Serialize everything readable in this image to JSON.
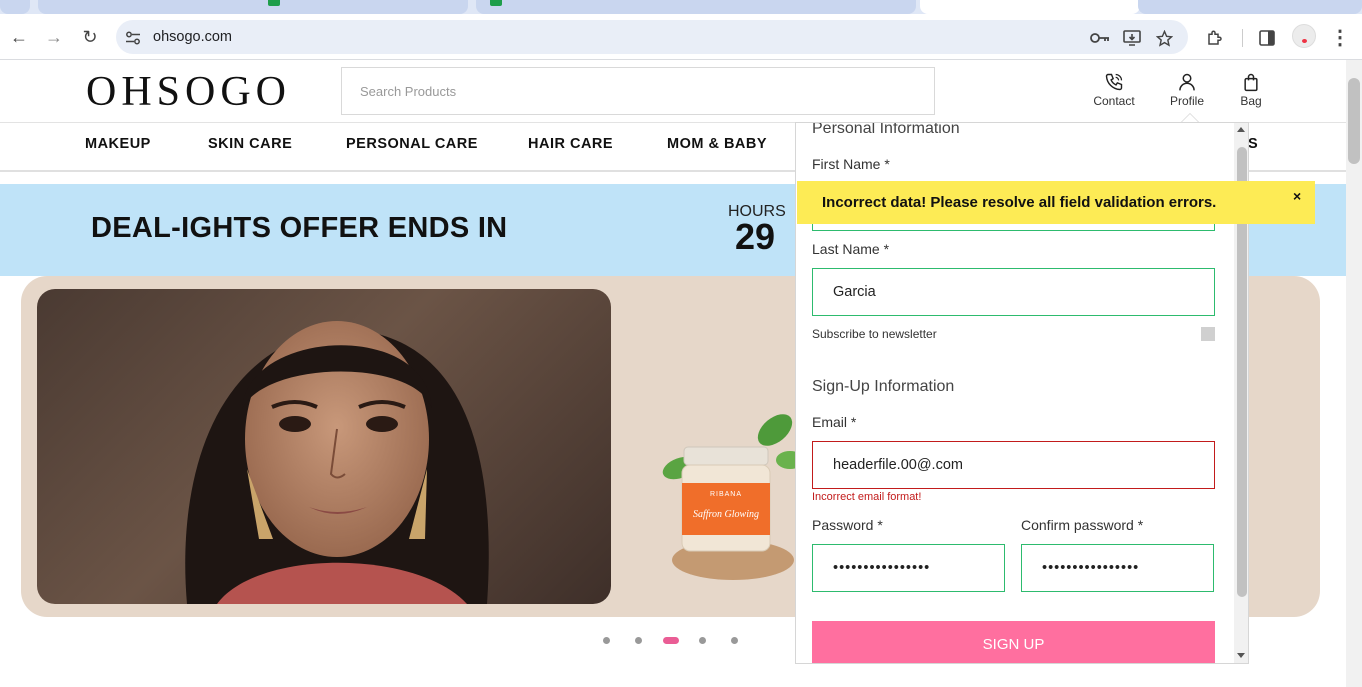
{
  "browser": {
    "url": "ohsogo.com",
    "back_icon": "←",
    "forward_icon": "→",
    "reload_icon": "↻",
    "menu_icon": "⋮"
  },
  "site": {
    "logo": "OHSOGO",
    "search_placeholder": "Search Products",
    "header_items": [
      {
        "label": "Contact",
        "icon": "phone-icon"
      },
      {
        "label": "Profile",
        "icon": "person-icon"
      },
      {
        "label": "Bag",
        "icon": "bag-icon"
      }
    ],
    "categories": [
      "MAKEUP",
      "SKIN CARE",
      "PERSONAL CARE",
      "HAIR CARE",
      "MOM & BABY",
      "S"
    ]
  },
  "deal": {
    "title": "DEAL-IGHTS OFFER ENDS IN",
    "hours_label": "HOURS",
    "hours_value": "29"
  },
  "hero": {
    "product_brand": "RIBANA",
    "product_name": "Saffron Glowing",
    "carousel_active_index": 2,
    "carousel_count": 5
  },
  "signup_form": {
    "personal_title": "Personal Information",
    "first_name_label": "First Name *",
    "last_name_label": "Last Name *",
    "last_name_value": "Garcia",
    "newsletter_label": "Subscribe to newsletter",
    "signup_title": "Sign-Up Information",
    "email_label": "Email *",
    "email_value": "headerfile.00@.com",
    "email_error": "Incorrect email format!",
    "password_label": "Password *",
    "password_value": "••••••••••••••••",
    "confirm_label": "Confirm password *",
    "confirm_value": "••••••••••••••••",
    "submit_label": "SIGN UP"
  },
  "toast": {
    "message": "Incorrect data! Please resolve all field validation errors.",
    "close_label": "×"
  },
  "colors": {
    "accent": "#ff6f9f",
    "error": "#c21b1b",
    "valid": "#2dbb6e",
    "toast_bg": "#fdeb55",
    "deal_bg": "#bfe3f8"
  }
}
